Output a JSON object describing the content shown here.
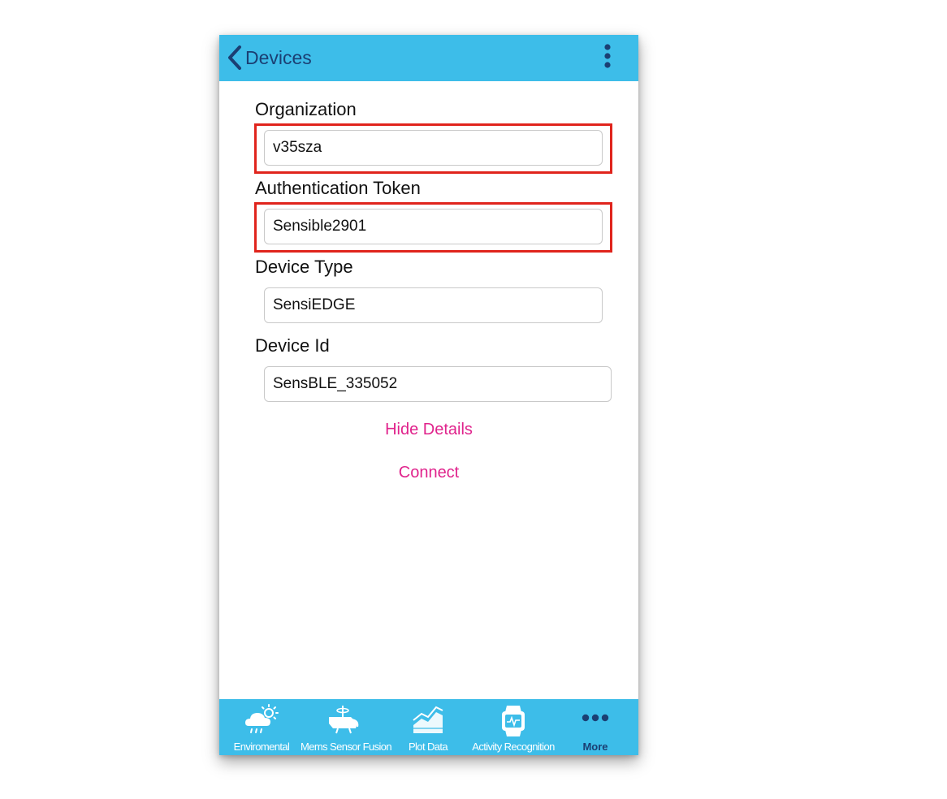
{
  "navbar": {
    "back_label": "Devices",
    "back_icon": "chevron-left-icon",
    "menu_icon": "more-vertical-icon"
  },
  "form": {
    "organization": {
      "label": "Organization",
      "value": "v35sza"
    },
    "auth_token": {
      "label": "Authentication Token",
      "value": "Sensible2901"
    },
    "device_type": {
      "label": "Device Type",
      "value": "SensiEDGE"
    },
    "device_id": {
      "label": "Device Id",
      "value": "SensBLE_335052"
    }
  },
  "actions": {
    "hide_details": "Hide Details",
    "connect": "Connect"
  },
  "tabbar": {
    "tabs": [
      {
        "label": "Enviromental",
        "icon": "weather-icon"
      },
      {
        "label": "Mems Sensor Fusion",
        "icon": "sensor-fusion-icon"
      },
      {
        "label": "Plot Data",
        "icon": "plot-chart-icon"
      },
      {
        "label": "Activity Recognition",
        "icon": "activity-watch-icon"
      },
      {
        "label": "More",
        "icon": "more-horizontal-icon"
      }
    ]
  },
  "colors": {
    "bar_blue": "#3dbde9",
    "nav_text": "#1b3f73",
    "link_pink": "#e0238c",
    "highlight_red": "#e0241c"
  }
}
